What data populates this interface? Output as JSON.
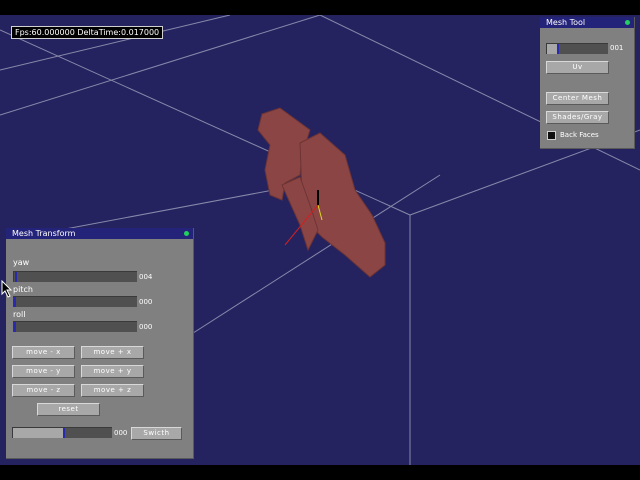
{
  "status": {
    "fps_text": "Fps:60.000000  DeltaTime:0.017000"
  },
  "mesh_tool": {
    "title": "Mesh  Tool",
    "slider_value": "001",
    "slider_level": 0.1,
    "uv_label": "Uv",
    "center_mesh_label": "Center Mesh",
    "shades_gray_label": "Shades/Gray",
    "back_faces_label": "Back Faces",
    "back_faces_checked": false
  },
  "mesh_transform": {
    "title": "Mesh  Transform",
    "yaw": {
      "label": "yaw",
      "value": "004",
      "level": 0.02
    },
    "pitch": {
      "label": "pitch",
      "value": "000",
      "level": 0.0
    },
    "roll": {
      "label": "roll",
      "value": "000",
      "level": 0.0
    },
    "move_minus_x": "move  -  x",
    "move_plus_x": "move  +  x",
    "move_minus_y": "move  -  y",
    "move_plus_y": "move  +  y",
    "move_minus_z": "move  -  z",
    "move_plus_z": "move  +  z",
    "reset_label": "reset",
    "switch_slider_value": "000",
    "switch_slider_level": 0.5,
    "switch_label": "Swicth"
  },
  "colors": {
    "background": "#24235f",
    "titlebar": "#24237a",
    "panel": "#808080",
    "mesh": "#8c4545",
    "status_dot": "#20d060"
  },
  "icons": {
    "cursor": "arrow-cursor-icon"
  }
}
